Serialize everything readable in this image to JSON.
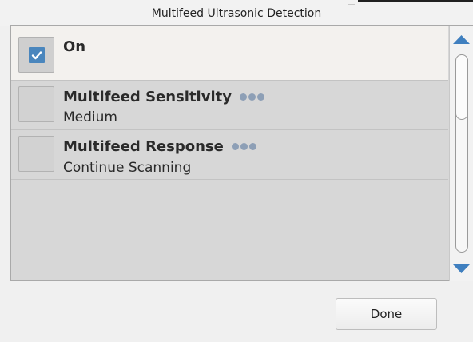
{
  "dialog": {
    "title": "Multifeed Ultrasonic Detection"
  },
  "list": {
    "items": [
      {
        "label": "On",
        "checked": true,
        "value": ""
      },
      {
        "label": "Multifeed Sensitivity",
        "checked": false,
        "value": "Medium",
        "more_icon": "ellipsis-icon"
      },
      {
        "label": "Multifeed Response",
        "checked": false,
        "value": "Continue Scanning",
        "more_icon": "ellipsis-icon"
      }
    ]
  },
  "footer": {
    "done_label": "Done"
  },
  "colors": {
    "accent": "#4a86bd",
    "dots": "#8d9fb6"
  }
}
